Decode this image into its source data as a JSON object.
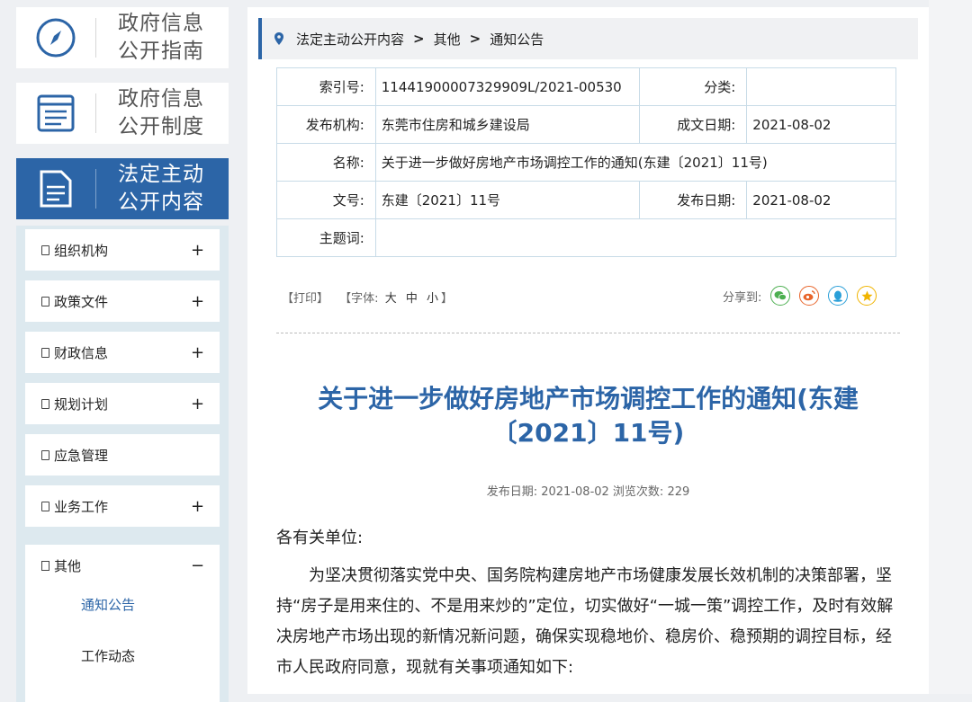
{
  "sidebar": {
    "cards": [
      {
        "label": "政府信息\n公开指南",
        "icon": "compass-icon"
      },
      {
        "label": "政府信息\n公开制度",
        "icon": "list-document-icon"
      },
      {
        "label": "法定主动\n公开内容",
        "icon": "document-icon"
      }
    ],
    "menu": [
      {
        "label": "组织机构",
        "toggle": "+"
      },
      {
        "label": "政策文件",
        "toggle": "+"
      },
      {
        "label": "财政信息",
        "toggle": "+"
      },
      {
        "label": "规划计划",
        "toggle": "+"
      },
      {
        "label": "应急管理",
        "toggle": ""
      },
      {
        "label": "业务工作",
        "toggle": "+"
      },
      {
        "label": "其他",
        "toggle": "−"
      }
    ],
    "sub_items": [
      {
        "label": "通知公告",
        "active": true
      },
      {
        "label": "工作动态",
        "active": false
      }
    ],
    "accent_color": "#2c65a7",
    "active_sub_color": "#2c65a7"
  },
  "breadcrumb": {
    "icon": "location-pin-icon",
    "items": [
      "法定主动公开内容",
      "其他",
      "通知公告"
    ],
    "separator": ">"
  },
  "meta": {
    "index_label": "索引号:",
    "index_value": "11441900007329909L/2021-00530",
    "category_label": "分类:",
    "category_value": "",
    "org_label": "发布机构:",
    "org_value": "东莞市住房和城乡建设局",
    "date_label": "成文日期:",
    "date_value": "2021-08-02",
    "name_label": "名称:",
    "name_value": "关于进一步做好房地产市场调控工作的通知(东建〔2021〕11号)",
    "docno_label": "文号:",
    "docno_value": "东建〔2021〕11号",
    "pub_label": "发布日期:",
    "pub_value": "2021-08-02",
    "topic_label": "主题词:",
    "topic_value": ""
  },
  "tools": {
    "print": "【打印】",
    "font_prefix": "【字体:",
    "font_large": "大",
    "font_medium": "中",
    "font_small": "小",
    "font_suffix": "】",
    "share_label": "分享到:",
    "share_icons": [
      "wechat-icon",
      "weibo-icon",
      "qq-icon",
      "qzone-icon"
    ]
  },
  "article": {
    "title": "关于进一步做好房地产市场调控工作的通知(东建〔2021〕11号)",
    "pubinfo": "发布日期: 2021-08-02  浏览次数: 229",
    "salutation": "各有关单位:",
    "paragraph1": "为坚决贯彻落实党中央、国务院构建房地产市场健康发展长效机制的决策部署，坚持“房子是用来住的、不是用来炒的”定位，切实做好“一城一策”调控工作，及时有效解决房地产市场出现的新情况新问题，确保实现稳地价、稳房价、稳预期的调控目标，经市人民政府同意，现就有关事项通知如下:"
  }
}
